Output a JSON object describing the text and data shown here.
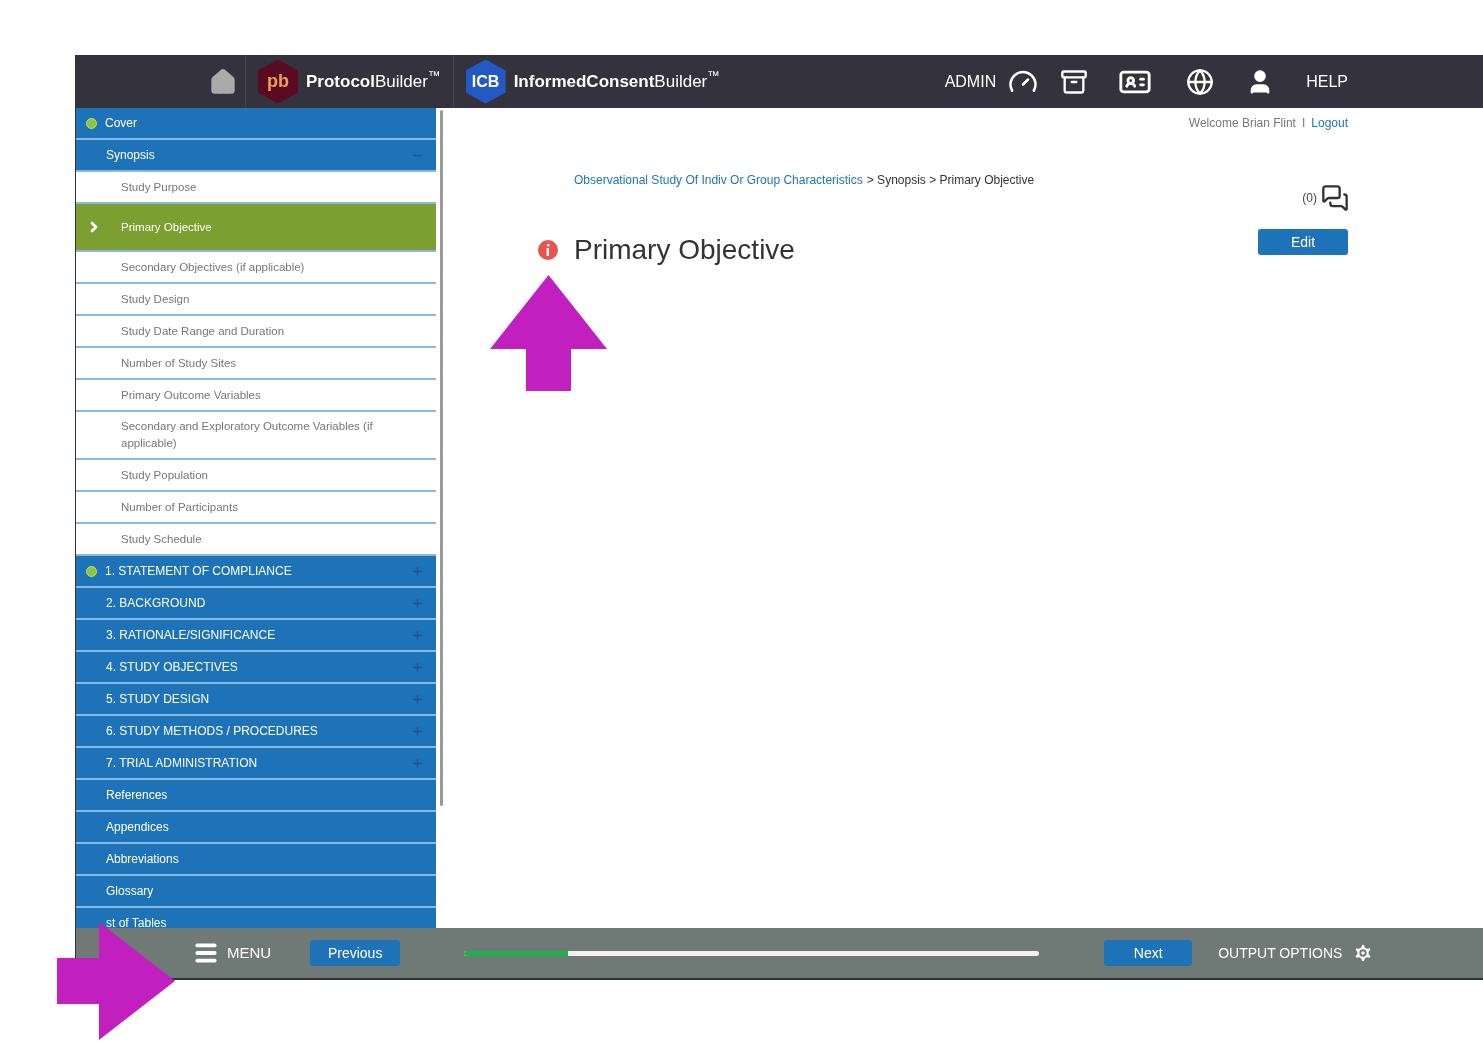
{
  "header": {
    "logos": [
      {
        "kind": "pb",
        "mark": "pb",
        "name": "**Protocol**Builder$^{™}$"
      },
      {
        "kind": "icb",
        "mark": "ICB",
        "name": "**InformedConsent**Builder$^{™}$"
      }
    ],
    "admin": "ADMIN",
    "help": "HELP"
  },
  "nav": [
    {
      "label": "Cover",
      "kind": "section",
      "completed": true
    },
    {
      "label": "Synopsis",
      "kind": "section",
      "completed": false,
      "expanded": true,
      "children": [
        {
          "label": "Study Purpose",
          "selected": false
        },
        {
          "label": "Primary Objective",
          "selected": true
        },
        {
          "label": "Secondary Objectives (if applicable)",
          "selected": false
        },
        {
          "label": "Study Design",
          "selected": false
        },
        {
          "label": "Study Date Range and Duration",
          "selected": false
        },
        {
          "label": "Number of Study Sites",
          "selected": false
        },
        {
          "label": "Primary Outcome Variables",
          "selected": false
        },
        {
          "label": "Secondary and Exploratory Outcome Variables (if applicable)",
          "selected": false
        },
        {
          "label": "Study Population",
          "selected": false
        },
        {
          "label": "Number of Participants",
          "selected": false
        },
        {
          "label": "Study Schedule",
          "selected": false
        }
      ]
    },
    {
      "label": "1. STATEMENT OF COMPLIANCE",
      "kind": "section",
      "completed": true,
      "expanded": false
    },
    {
      "label": "2. BACKGROUND",
      "kind": "section",
      "completed": false,
      "expanded": false
    },
    {
      "label": "3. RATIONALE/SIGNIFICANCE",
      "kind": "section",
      "completed": false,
      "expanded": false
    },
    {
      "label": "4. STUDY OBJECTIVES",
      "kind": "section",
      "completed": false,
      "expanded": false
    },
    {
      "label": "5. STUDY DESIGN",
      "kind": "section",
      "completed": false,
      "expanded": false
    },
    {
      "label": "6. STUDY METHODS / PROCEDURES",
      "kind": "section",
      "completed": false,
      "expanded": false
    },
    {
      "label": "7. TRIAL ADMINISTRATION",
      "kind": "section",
      "completed": false,
      "expanded": false
    },
    {
      "label": "References",
      "kind": "section",
      "completed": false
    },
    {
      "label": "Appendices",
      "kind": "section",
      "completed": false
    },
    {
      "label": "Abbreviations",
      "kind": "section",
      "completed": false
    },
    {
      "label": "Glossary",
      "kind": "section",
      "completed": false
    },
    {
      "label": "st of Tables",
      "kind": "section",
      "completed": false
    }
  ],
  "user": {
    "welcome": "Welcome",
    "name": "Brian Flint",
    "separator": "I",
    "logout": "Logout"
  },
  "breadcrumb": {
    "link": "Observational Study Of Indiv Or Group Characteristics",
    "rest": "> Synopsis > Primary Objective"
  },
  "comments": {
    "count": "(0)"
  },
  "page": {
    "title": "Primary Objective",
    "edit": "Edit"
  },
  "footer": {
    "menu": "MENU",
    "previous": "Previous",
    "progress": {
      "level": 0.18
    },
    "next": "Next",
    "output": "OUTPUT OPTIONS"
  }
}
